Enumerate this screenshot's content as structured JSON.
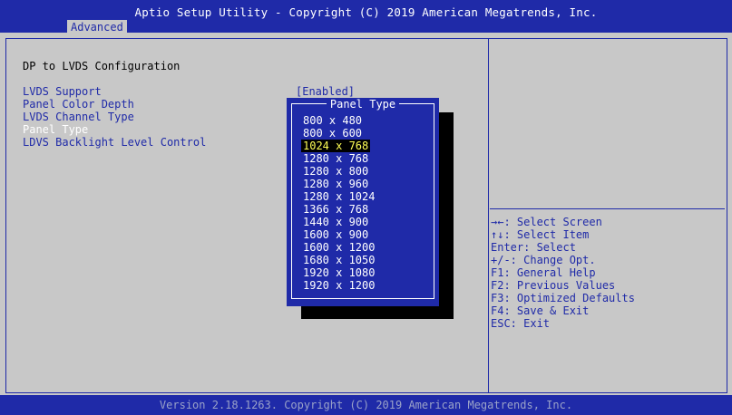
{
  "header": {
    "title": "Aptio Setup Utility - Copyright (C) 2019 American Megatrends, Inc.",
    "tab": "Advanced"
  },
  "main": {
    "section_title": "DP to LVDS Configuration",
    "settings": [
      {
        "label": "LVDS Support",
        "value": "[Enabled]"
      },
      {
        "label": "Panel Color Depth",
        "value": ""
      },
      {
        "label": "LVDS Channel Type",
        "value": ""
      },
      {
        "label": "Panel Type",
        "value": ""
      },
      {
        "label": "LDVS Backlight Level Control",
        "value": ""
      }
    ],
    "selected_index": 3
  },
  "popup": {
    "title": "Panel Type",
    "options": [
      "800 x 480",
      "800 x 600",
      "1024 x 768",
      "1280 x 768",
      "1280 x 800",
      "1280 x 960",
      "1280 x 1024",
      "1366 x 768",
      "1440 x 900",
      "1600 x 900",
      "1600 x 1200",
      "1680 x 1050",
      "1920 x 1080",
      "1920 x 1200"
    ],
    "highlighted_index": 2
  },
  "help": {
    "lines": [
      "→←: Select Screen",
      "↑↓: Select Item",
      "Enter: Select",
      "+/-: Change Opt.",
      "F1: General Help",
      "F2: Previous Values",
      "F3: Optimized Defaults",
      "F4: Save & Exit",
      "ESC: Exit"
    ]
  },
  "footer": {
    "text": "Version 2.18.1263. Copyright (C) 2019 American Megatrends, Inc."
  },
  "colors": {
    "bios_blue": "#1f2aa8",
    "panel_gray": "#c8c8c8",
    "highlight_text": "#ffff55",
    "selected_text": "#ffffff"
  }
}
